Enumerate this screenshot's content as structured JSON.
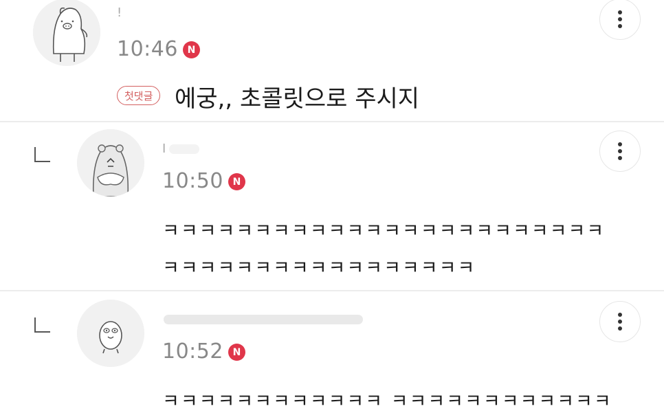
{
  "comments": [
    {
      "author": "!",
      "time": "10:46",
      "new_badge": "N",
      "first_badge": "첫댓글",
      "text": "에궁,, 초콜릿으로 주시지",
      "avatar_icon": "pig-character-icon",
      "is_reply": false
    },
    {
      "author": "I",
      "time": "10:50",
      "new_badge": "N",
      "lines": [
        "ㅋㅋㅋㅋㅋㅋㅋㅋㅋㅋㅋㅋㅋㅋㅋㅋㅋㅋㅋㅋㅋㅋㅋㅋ",
        "ㅋㅋㅋㅋㅋㅋㅋㅋㅋㅋㅋㅋㅋㅋㅋㅋㅋ"
      ],
      "avatar_icon": "bear-character-icon",
      "is_reply": true
    },
    {
      "author": "",
      "time": "10:52",
      "new_badge": "N",
      "lines": [
        "ㅋㅋㅋㅋㅋㅋㅋㅋㅋㅋㅋㅋ ㅋㅋㅋㅋㅋㅋㅋㅋㅋㅋㅋㅋ"
      ],
      "avatar_icon": "chick-character-icon",
      "is_reply": true
    }
  ],
  "colors": {
    "accent_red": "#e0364a",
    "first_badge": "#d35f5f"
  },
  "icons": {
    "more": "vertical-ellipsis-icon",
    "reply": "reply-corner-icon"
  }
}
